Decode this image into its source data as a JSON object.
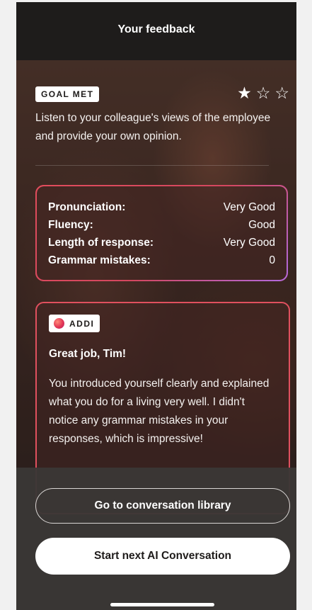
{
  "header": {
    "title": "Your feedback"
  },
  "goal": {
    "badge": "GOAL MET",
    "stars": {
      "filled": 1,
      "total": 3,
      "filled_glyph": "★",
      "empty_glyph": "☆"
    },
    "task": "Listen to your colleague's views of the employee and provide your own opinion."
  },
  "scores": [
    {
      "label": "Pronunciation:",
      "value": "Very Good"
    },
    {
      "label": "Fluency:",
      "value": "Good"
    },
    {
      "label": "Length of response:",
      "value": "Very Good"
    },
    {
      "label": "Grammar mistakes:",
      "value": "0"
    }
  ],
  "addi": {
    "badge": "ADDI",
    "greeting": "Great job, Tim!",
    "message": "You introduced yourself clearly and explained what you do for a living very well. I didn't notice any grammar mistakes in your responses, which is impressive!"
  },
  "actions": {
    "library_label": "Go to conversation library",
    "next_label": "Start next AI Conversation"
  },
  "colors": {
    "accent_border": "#e0505e",
    "accent_border_end": "#b16adf",
    "header_bg": "#1e1c1b",
    "panel_bg": "#3a3735"
  }
}
